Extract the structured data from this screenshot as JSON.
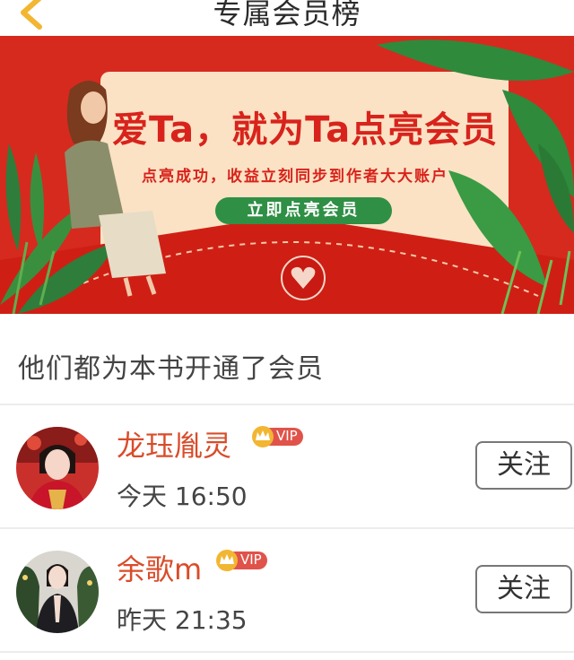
{
  "header": {
    "title": "专属会员榜",
    "back_icon": "chevron-left-icon"
  },
  "banner": {
    "title": "爱Ta，就为Ta点亮会员",
    "subtitle": "点亮成功，收益立刻同步到作者大大账户",
    "cta_label": "立即点亮会员"
  },
  "section": {
    "title": "他们都为本书开通了会员"
  },
  "members": [
    {
      "name": "龙珏胤灵",
      "badge": "VIP",
      "time": "今天 16:50",
      "follow_label": "关注"
    },
    {
      "name": "余歌m",
      "badge": "VIP",
      "time": "昨天 21:35",
      "follow_label": "关注"
    }
  ],
  "colors": {
    "accent_red": "#d8231c",
    "name_color": "#d94c2a",
    "cta_green": "#2f8f45",
    "gold": "#f2b632"
  }
}
